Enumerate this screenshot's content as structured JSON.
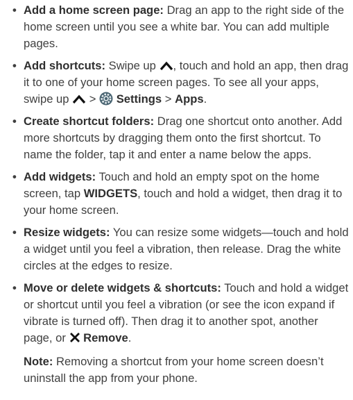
{
  "items": [
    {
      "title": "Add a home screen page:",
      "text": "Drag an app to the right side of the home screen until you see a white bar. You can add multiple pages."
    },
    {
      "title": "Add shortcuts:",
      "text_a": "Swipe up",
      "text_b": ", touch and hold an app, then drag it to one of your home screen pages. To see all your apps, swipe up",
      "sep1": ">",
      "settings_label": "Settings",
      "sep2": ">",
      "apps_label": "Apps",
      "end": ".",
      "icons": [
        "swipe-up-chevron-icon",
        "settings-gear-icon"
      ]
    },
    {
      "title": "Create shortcut folders:",
      "text": "Drag one shortcut onto another. Add more shortcuts by dragging them onto the first shortcut. To name the folder, tap it and enter a name below the apps."
    },
    {
      "title": "Add widgets:",
      "text_a": "Touch and hold an empty spot on the home screen, tap",
      "widgets_label": "WIDGETS",
      "text_b": ", touch and hold a widget, then drag it to your home screen."
    },
    {
      "title": "Resize widgets:",
      "text": "You can resize some widgets—touch and hold a widget until you feel a vibration, then release. Drag the white circles at the edges to resize."
    },
    {
      "title": "Move or delete widgets & shortcuts:",
      "text": "Touch and hold a widget or shortcut until you feel a vibration (or see the icon expand if vibrate is turned off). Then drag it to another spot, another page, or",
      "remove_label": "Remove",
      "end": ".",
      "icons": [
        "remove-x-icon"
      ]
    }
  ],
  "note": {
    "label": "Note:",
    "text": "Removing a shortcut from your home screen doesn’t uninstall the app from your phone."
  },
  "colors": {
    "text": "#3f3f3f",
    "heading": "#2f2f2f"
  }
}
